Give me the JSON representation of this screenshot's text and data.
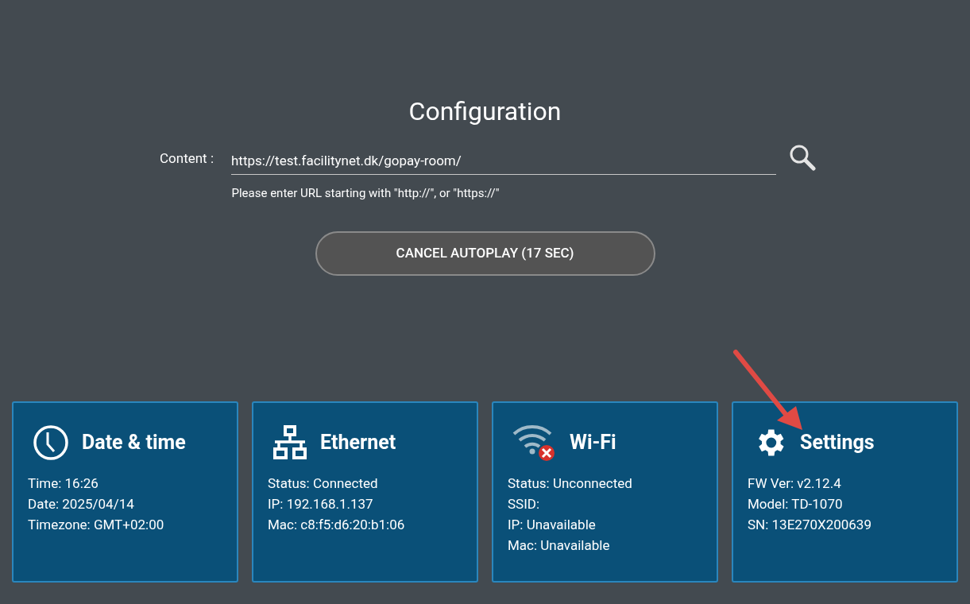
{
  "title": "Configuration",
  "content": {
    "label": "Content :",
    "value": "https://test.facilitynet.dk/gopay-room/",
    "hint": "Please enter URL starting with \"http://\", or \"https://\""
  },
  "autoplay_button": "CANCEL AUTOPLAY (17 SEC)",
  "cards": [
    {
      "kind": "clock",
      "title": "Date & time",
      "lines": [
        "Time: 16:26",
        "Date: 2025/04/14",
        "Timezone: GMT+02:00"
      ]
    },
    {
      "kind": "ethernet",
      "title": "Ethernet",
      "lines": [
        "Status: Connected",
        "IP: 192.168.1.137",
        "Mac: c8:f5:d6:20:b1:06"
      ]
    },
    {
      "kind": "wifi",
      "title": "Wi-Fi",
      "lines": [
        "Status: Unconnected",
        "SSID:",
        "IP: Unavailable",
        "Mac: Unavailable"
      ]
    },
    {
      "kind": "settings",
      "title": "Settings",
      "lines": [
        "FW Ver: v2.12.4",
        "Model: TD-1070",
        "SN: 13E270X200639"
      ]
    }
  ]
}
